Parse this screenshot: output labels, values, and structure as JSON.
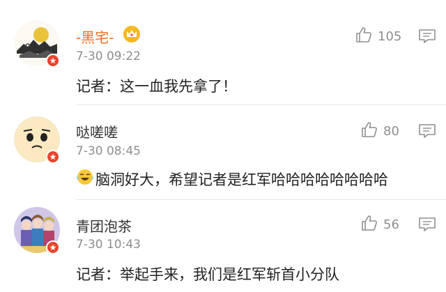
{
  "comments": [
    {
      "user": "-黑宅-",
      "vip": true,
      "time": "7-30 09:22",
      "text": "记者：这一血我先拿了！",
      "likes": "105",
      "avatar_icon": "ink-mountain-landscape-avatar",
      "user_icon": "crown-icon"
    },
    {
      "user": "哒嗟嗟",
      "vip": false,
      "time": "7-30 08:45",
      "emoji": "crying-laughing-emoji",
      "text": "脑洞好大，希望记者是红军哈哈哈哈哈哈哈哈",
      "likes": "80",
      "avatar_icon": "sad-face-avatar"
    },
    {
      "user": "青团泡茶",
      "vip": false,
      "time": "7-30 10:43",
      "text": "记者：举起手来，我们是红军斩首小分队",
      "likes": "56",
      "avatar_icon": "anime-characters-avatar"
    }
  ],
  "colors": {
    "vip_name": "#f26d22",
    "badge": "#e8432b",
    "meta": "#8e8e8e"
  }
}
